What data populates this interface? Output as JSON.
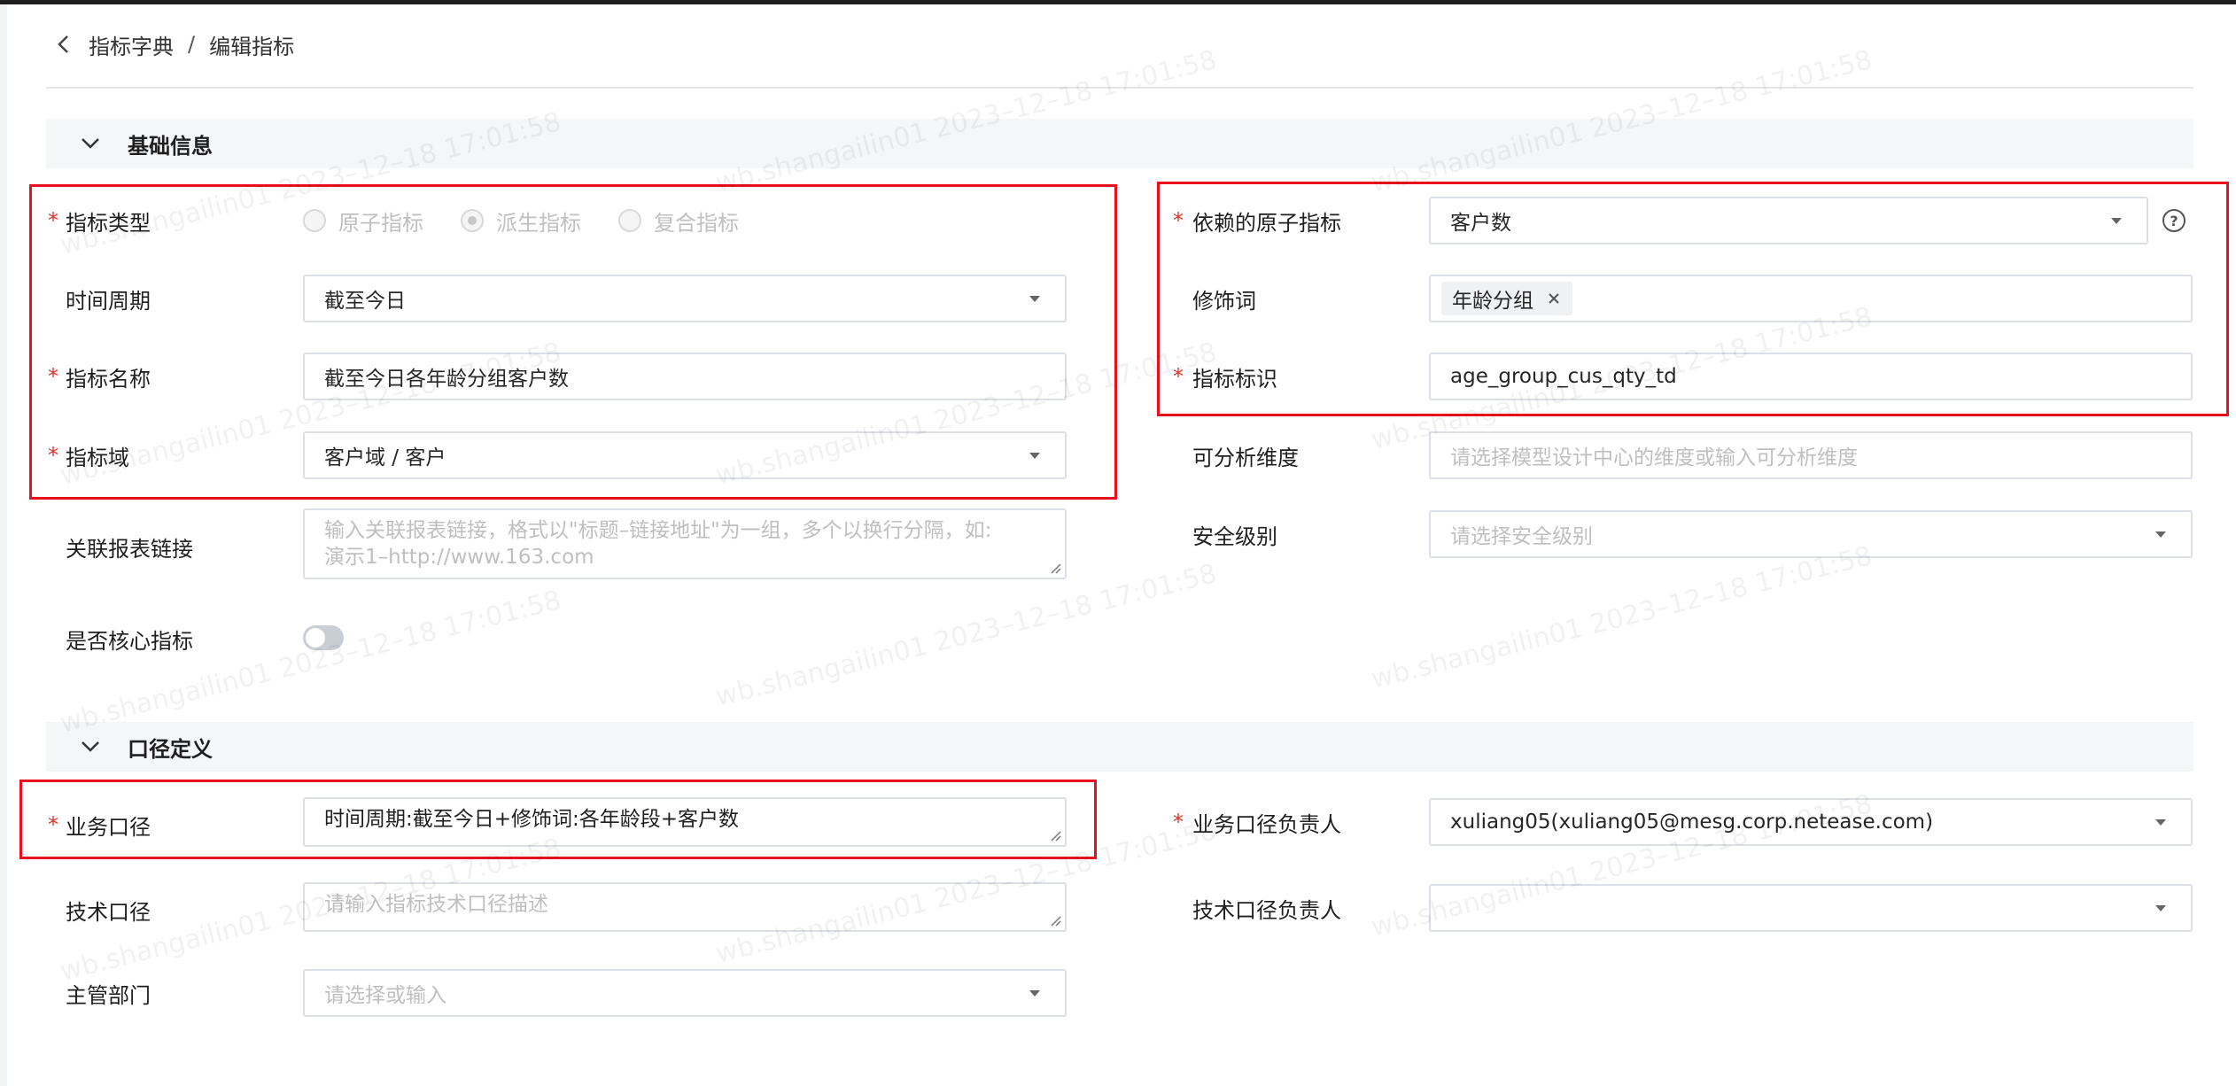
{
  "breadcrumb": {
    "parent": "指标字典",
    "separator": "/",
    "current": "编辑指标"
  },
  "sections": {
    "basic": "基础信息",
    "caliber": "口径定义"
  },
  "basic": {
    "metric_type": {
      "label": "指标类型",
      "options": [
        "原子指标",
        "派生指标",
        "复合指标"
      ],
      "selected": "派生指标"
    },
    "time_period": {
      "label": "时间周期",
      "value": "截至今日"
    },
    "metric_name": {
      "label": "指标名称",
      "value": "截至今日各年龄分组客户数"
    },
    "metric_domain": {
      "label": "指标域",
      "value": "客户域 / 客户"
    },
    "report_link": {
      "label": "关联报表链接",
      "placeholder_line1": "输入关联报表链接，格式以\"标题–链接地址\"为一组，多个以换行分隔，如:",
      "placeholder_line2": "演示1–http://www.163.com"
    },
    "core_metric": {
      "label": "是否核心指标",
      "enabled": false
    },
    "atomic_metric": {
      "label": "依赖的原子指标",
      "value": "客户数"
    },
    "modifier": {
      "label": "修饰词",
      "tag": "年龄分组"
    },
    "metric_id": {
      "label": "指标标识",
      "value": "age_group_cus_qty_td"
    },
    "dimensions": {
      "label": "可分析维度",
      "placeholder": "请选择模型设计中心的维度或输入可分析维度"
    },
    "security": {
      "label": "安全级别",
      "placeholder": "请选择安全级别"
    }
  },
  "caliber": {
    "business": {
      "label": "业务口径",
      "value": "时间周期:截至今日+修饰词:各年龄段+客户数"
    },
    "technical": {
      "label": "技术口径",
      "placeholder": "请输入指标技术口径描述"
    },
    "department": {
      "label": "主管部门",
      "placeholder": "请选择或输入"
    },
    "business_owner": {
      "label": "业务口径负责人",
      "value": "xuliang05(xuliang05@mesg.corp.netease.com)"
    },
    "technical_owner": {
      "label": "技术口径负责人",
      "value": ""
    }
  },
  "required_mark": "*",
  "watermark": "wb.shangailin01 2023–12–18 17:01:58",
  "colors": {
    "highlight": "#e8101e",
    "required": "#e0302a",
    "section_bg": "#f5f6f8"
  }
}
